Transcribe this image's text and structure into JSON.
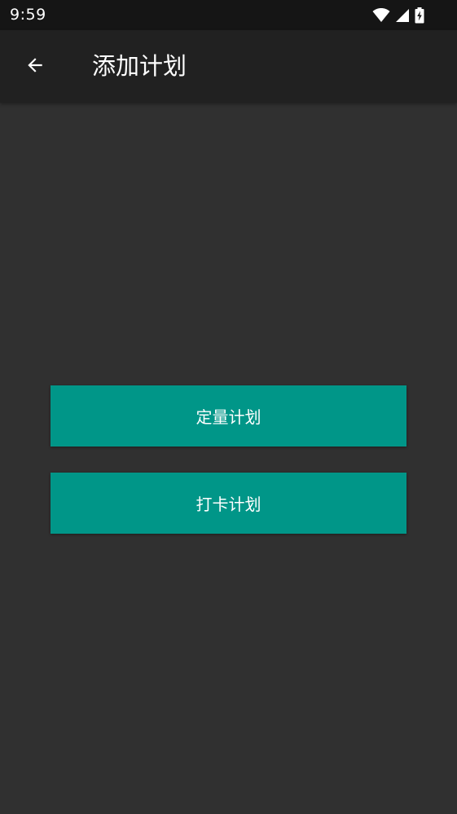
{
  "status_bar": {
    "time": "9:59",
    "icons": [
      "wifi-icon",
      "cellular-signal-icon",
      "battery-charging-icon"
    ]
  },
  "app_bar": {
    "back_icon": "arrow-left-icon",
    "title": "添加计划"
  },
  "buttons": {
    "quantity_plan": "定量计划",
    "checkin_plan": "打卡计划"
  },
  "colors": {
    "background": "#303030",
    "app_bar": "#212121",
    "status_bar": "#151515",
    "accent": "#009688",
    "text": "#ffffff"
  }
}
